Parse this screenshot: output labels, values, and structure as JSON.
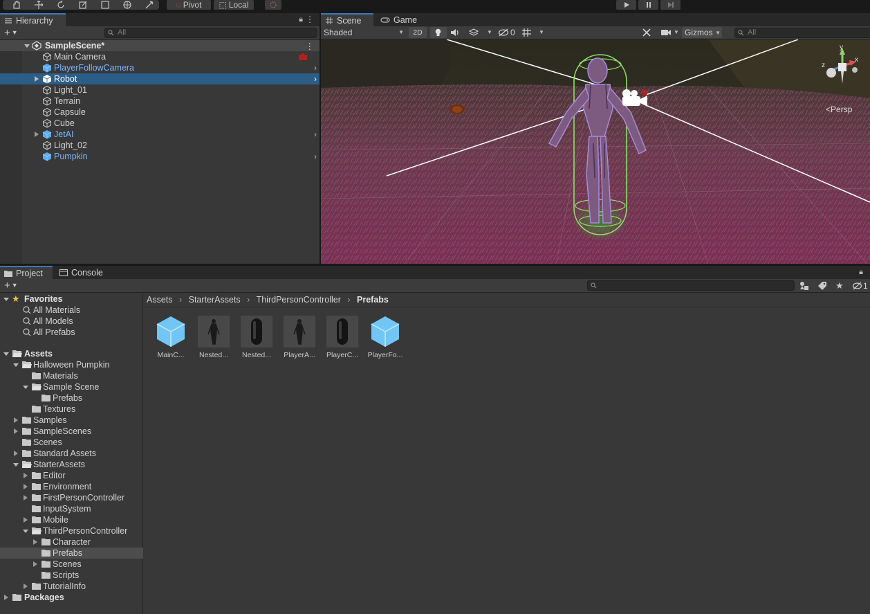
{
  "toolbar": {
    "pivot_label": "Pivot",
    "local_label": "Local"
  },
  "hierarchy": {
    "tab_label": "Hierarchy",
    "search_placeholder": "All",
    "scene_name": "SampleScene*",
    "items": [
      {
        "label": "Main Camera",
        "prefab": false
      },
      {
        "label": "PlayerFollowCamera",
        "prefab": true
      },
      {
        "label": "Robot",
        "prefab": true
      },
      {
        "label": "Light_01",
        "prefab": false
      },
      {
        "label": "Terrain",
        "prefab": false
      },
      {
        "label": "Capsule",
        "prefab": false
      },
      {
        "label": "Cube",
        "prefab": false
      },
      {
        "label": "JetAI",
        "prefab": true
      },
      {
        "label": "Light_02",
        "prefab": false
      },
      {
        "label": "Pumpkin",
        "prefab": true
      }
    ]
  },
  "scene": {
    "tab_scene": "Scene",
    "tab_game": "Game",
    "shading_mode": "Shaded",
    "btn_2d": "2D",
    "hidden_count": "0",
    "gizmos_label": "Gizmos",
    "search_placeholder": "All",
    "axis_x": "x",
    "axis_y": "y",
    "axis_z": "z",
    "persp_label": "Persp"
  },
  "project": {
    "tab_project": "Project",
    "tab_console": "Console",
    "favorites_label": "Favorites",
    "favorites": [
      "All Materials",
      "All Models",
      "All Prefabs"
    ],
    "assets_label": "Assets",
    "packages_label": "Packages",
    "layer_count": "1",
    "tree": [
      {
        "label": "Halloween Pumpkin"
      },
      {
        "label": "Materials"
      },
      {
        "label": "Sample Scene"
      },
      {
        "label": "Prefabs"
      },
      {
        "label": "Textures"
      },
      {
        "label": "Samples"
      },
      {
        "label": "SampleScenes"
      },
      {
        "label": "Scenes"
      },
      {
        "label": "Standard Assets"
      },
      {
        "label": "StarterAssets"
      },
      {
        "label": "Editor"
      },
      {
        "label": "Environment"
      },
      {
        "label": "FirstPersonController"
      },
      {
        "label": "InputSystem"
      },
      {
        "label": "Mobile"
      },
      {
        "label": "ThirdPersonController"
      },
      {
        "label": "Character"
      },
      {
        "label": "Prefabs"
      },
      {
        "label": "Scenes"
      },
      {
        "label": "Scripts"
      },
      {
        "label": "TutorialInfo"
      }
    ],
    "breadcrumb": [
      "Assets",
      "StarterAssets",
      "ThirdPersonController",
      "Prefabs"
    ],
    "assets": [
      {
        "name": "MainC...",
        "kind": "cube"
      },
      {
        "name": "Nested...",
        "kind": "figure"
      },
      {
        "name": "Nested...",
        "kind": "capsule"
      },
      {
        "name": "PlayerA...",
        "kind": "figure"
      },
      {
        "name": "PlayerC...",
        "kind": "capsule"
      },
      {
        "name": "PlayerFo...",
        "kind": "cube"
      }
    ]
  },
  "colors": {
    "accent": "#3a79bb",
    "selection": "#2c5d87",
    "prefab_text": "#7cb4ff",
    "panel_bg": "#383838"
  }
}
